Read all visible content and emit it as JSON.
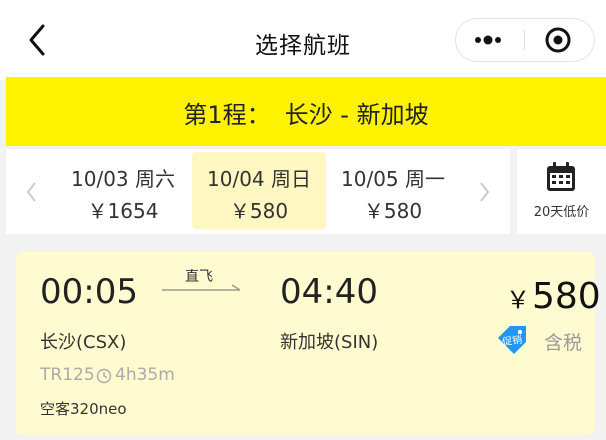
{
  "nav": {
    "title": "选择航班",
    "back_icon": "chevron-left-icon",
    "more_icon": "more-dots-icon",
    "close_icon": "target-circle-icon"
  },
  "segment": {
    "label": "第1程：",
    "route": "长沙 - 新加坡",
    "background": "#fff200"
  },
  "dates": [
    {
      "label": "10/03 周六",
      "price": "￥1654",
      "selected": false
    },
    {
      "label": "10/04 周日",
      "price": "￥580",
      "selected": true
    },
    {
      "label": "10/05 周一",
      "price": "￥580",
      "selected": false
    }
  ],
  "low_price": {
    "icon": "calendar-icon",
    "label": "20天低价"
  },
  "flight": {
    "dep_time": "00:05",
    "arr_time": "04:40",
    "direct": "直飞",
    "dep_city": "长沙(CSX)",
    "arr_city": "新加坡(SIN)",
    "currency": "￥",
    "price": "580",
    "promo": "促销",
    "tax": "含税",
    "flight_no": "TR125",
    "duration": "4h35m",
    "aircraft": "空客320neo",
    "promo_color": "#2196f3",
    "card_color": "#fffbd0"
  }
}
